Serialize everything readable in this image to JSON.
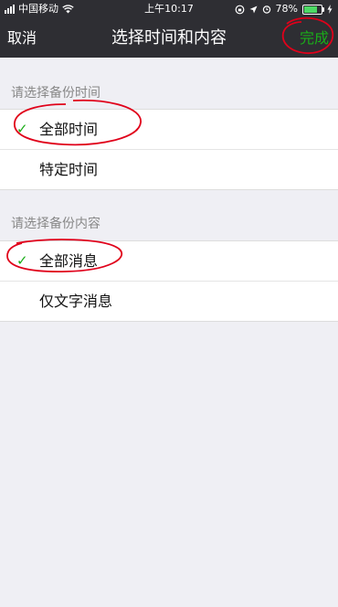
{
  "status_bar": {
    "carrier": "中国移动",
    "time": "上午10:17",
    "battery_percent": "78%",
    "battery_level": 0.78
  },
  "nav": {
    "cancel_label": "取消",
    "title": "选择时间和内容",
    "done_label": "完成"
  },
  "time_section": {
    "header": "请选择备份时间",
    "options": [
      {
        "label": "全部时间",
        "selected": true
      },
      {
        "label": "特定时间",
        "selected": false
      }
    ]
  },
  "content_section": {
    "header": "请选择备份内容",
    "options": [
      {
        "label": "全部消息",
        "selected": true
      },
      {
        "label": "仅文字消息",
        "selected": false
      }
    ]
  },
  "colors": {
    "navbar_bg": "#2e2e33",
    "accent_green": "#1aad19",
    "page_bg": "#efeff4",
    "annotation_red": "#e0001a"
  },
  "icons": {
    "check": "✓"
  }
}
